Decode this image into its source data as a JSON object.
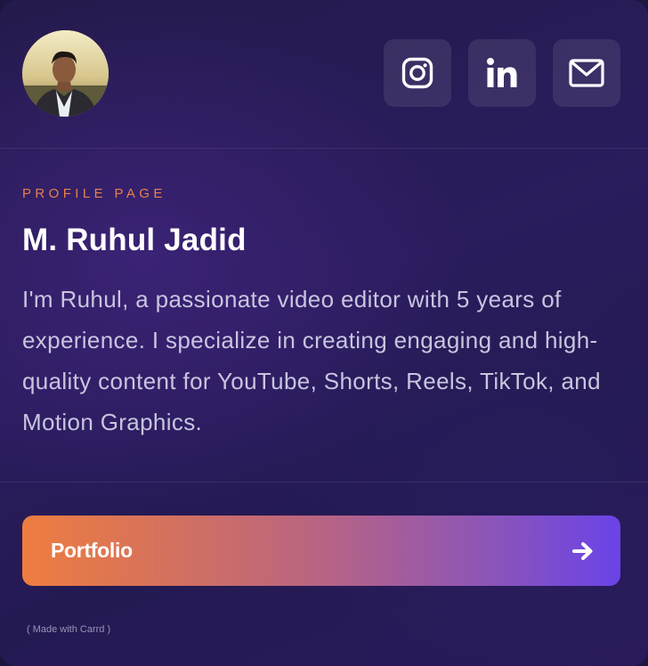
{
  "profile": {
    "avatar_alt": "Profile photo",
    "eyebrow": "PROFILE PAGE",
    "name": "M. Ruhul Jadid",
    "bio": "I'm Ruhul, a passionate video editor with 5 years of experience. I specialize in creating engaging and high-quality content for YouTube, Shorts, Reels, TikTok, and Motion Graphics."
  },
  "social": [
    {
      "icon": "instagram-icon"
    },
    {
      "icon": "linkedin-icon"
    },
    {
      "icon": "mail-icon"
    }
  ],
  "cta": {
    "label": "Portfolio",
    "icon": "arrow-right-icon"
  },
  "footer": {
    "made_with": "( Made with Carrd )"
  },
  "colors": {
    "accent_orange": "#e8804a",
    "accent_purple": "#6a43e8",
    "background": "#2b1c5d"
  }
}
